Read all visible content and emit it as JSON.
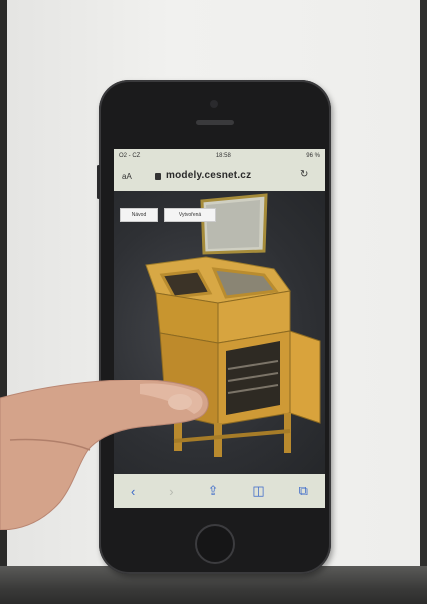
{
  "photo": {
    "subject": "Hand pointing at smartphone showing 3D model viewer of a wooden cabinet",
    "browser": {
      "status_left": "O2 - CZ",
      "status_time": "18:58",
      "status_right": "96 %",
      "aa_label": "aA",
      "url": "modely.cesnet.cz",
      "reload_icon": "reload-icon"
    },
    "viewer_buttons": [
      {
        "label": "Návod"
      },
      {
        "label": "Vytvořená"
      }
    ],
    "toolbar_icons": [
      "back-icon",
      "forward-icon",
      "share-icon",
      "bookmarks-icon",
      "tabs-icon"
    ],
    "toolbar_glyphs": [
      "‹",
      "›",
      "⇪",
      "◫",
      "⧉"
    ]
  }
}
